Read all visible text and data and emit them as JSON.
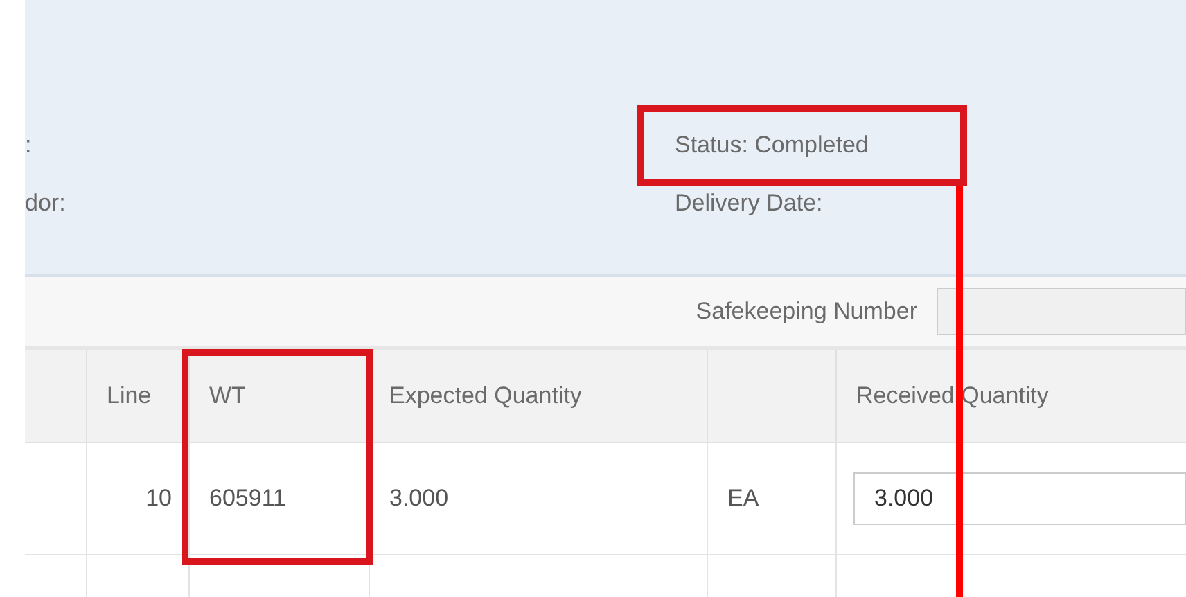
{
  "header": {
    "left_fields": [
      ":",
      "dor:"
    ],
    "status": {
      "text": "Status: Completed",
      "highlighted": true,
      "leader_line": true
    },
    "delivery_date": "Delivery Date:"
  },
  "toolbar": {
    "label": "Safekeeping Number"
  },
  "table": {
    "columns": [
      {
        "highlighted": false
      },
      {
        "label": "Line",
        "highlighted": false
      },
      {
        "label": "WT",
        "highlighted": true
      },
      {
        "label": "Expected Quantity",
        "highlighted": false
      },
      {
        "highlighted": false
      },
      {
        "label": "Received Quantity",
        "highlighted": false
      }
    ],
    "rows": [
      {
        "cells": [
          "",
          "10",
          "605911",
          "3.000",
          "EA"
        ],
        "received": "3.000"
      }
    ]
  }
}
